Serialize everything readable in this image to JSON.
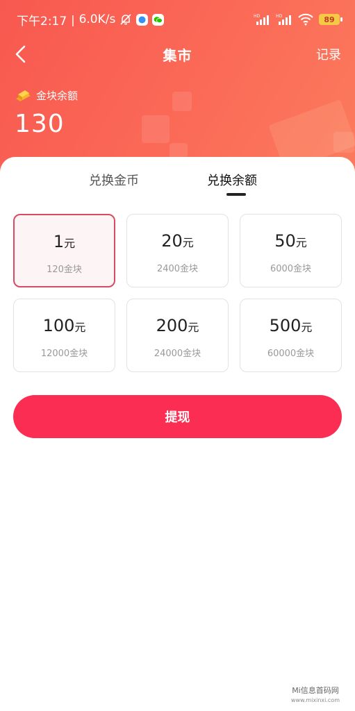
{
  "status_bar": {
    "time": "下午2:17",
    "network_speed": "6.0K/s",
    "battery": "89",
    "icons": [
      "mute-bell-icon",
      "app-icon",
      "wechat-icon",
      "hd-signal-icon",
      "hd-signal-icon",
      "wifi-icon",
      "battery-icon"
    ]
  },
  "nav": {
    "title": "集市",
    "record_label": "记录",
    "back_icon": "chevron-left-icon"
  },
  "balance": {
    "label": "金块余额",
    "value": "130",
    "icon": "gold-bar-icon"
  },
  "tabs": [
    {
      "label": "兑换金币",
      "active": false
    },
    {
      "label": "兑换余额",
      "active": true
    }
  ],
  "options": [
    {
      "amount": "1",
      "unit": "元",
      "cost": "120金块",
      "selected": true
    },
    {
      "amount": "20",
      "unit": "元",
      "cost": "2400金块",
      "selected": false
    },
    {
      "amount": "50",
      "unit": "元",
      "cost": "6000金块",
      "selected": false
    },
    {
      "amount": "100",
      "unit": "元",
      "cost": "12000金块",
      "selected": false
    },
    {
      "amount": "200",
      "unit": "元",
      "cost": "24000金块",
      "selected": false
    },
    {
      "amount": "500",
      "unit": "元",
      "cost": "60000金块",
      "selected": false
    }
  ],
  "withdraw_label": "提现",
  "watermark": {
    "text": "Mi信息首码网",
    "url": "www.mixinxi.com"
  },
  "colors": {
    "header_gradient_start": "#f8584f",
    "header_gradient_end": "#fb7b5d",
    "accent": "#fc2d52",
    "selected_border": "#d64b61"
  }
}
